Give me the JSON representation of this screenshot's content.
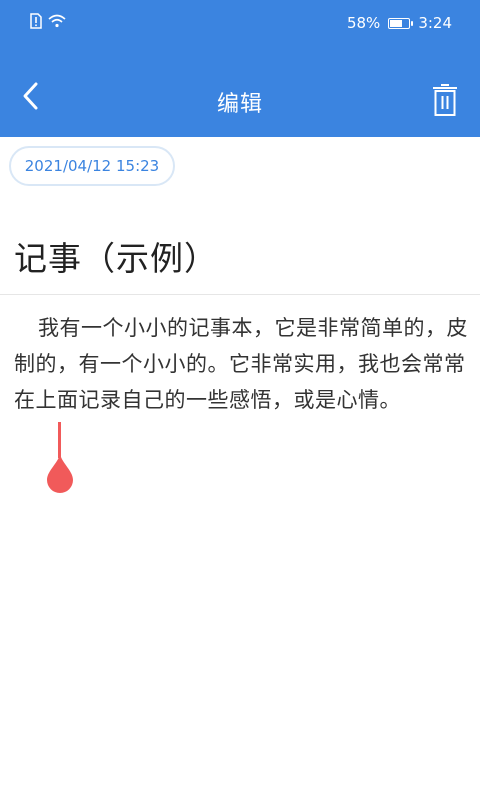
{
  "status_bar": {
    "battery_percent_text": "58%",
    "time": "3:24",
    "icons": [
      "sim-alert-icon",
      "wifi-icon",
      "battery-icon"
    ]
  },
  "header": {
    "title": "编辑",
    "back_icon": "chevron-left-icon",
    "delete_icon": "trash-icon"
  },
  "note": {
    "date": "2021/04/12 15:23",
    "title": "记事（示例）",
    "body": "我有一个小小的记事本，它是非常简单的，皮制的，有一个小小的。它非常实用，我也会常常在上面记录自己的一些感悟，或是心情。"
  },
  "colors": {
    "primary": "#3b84e0",
    "cursor": "#f15a5a",
    "chip_border": "#d9e7f6",
    "title_text": "#222222",
    "body_text": "#333333"
  }
}
